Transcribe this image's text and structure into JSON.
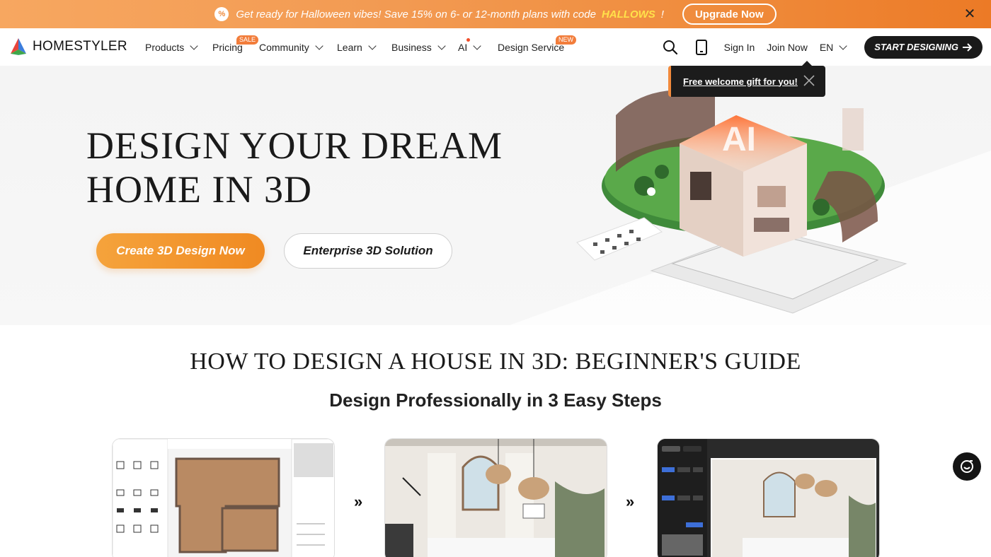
{
  "promo": {
    "text": "Get ready for Halloween vibes! Save 15% on 6- or 12-month plans with code",
    "code": "HALLOWS",
    "suffix": "!",
    "icon": "percent-icon",
    "upgrade_label": "Upgrade Now",
    "close_icon": "close-icon"
  },
  "nav": {
    "brand": "HOMESTYLER",
    "items": [
      {
        "label": "Products",
        "has_dropdown": true
      },
      {
        "label": "Pricing",
        "badge": "SALE"
      },
      {
        "label": "Community",
        "has_dropdown": true
      },
      {
        "label": "Learn",
        "has_dropdown": true
      },
      {
        "label": "Business",
        "has_dropdown": true
      },
      {
        "label": "AI",
        "has_dropdown": true
      },
      {
        "label": "Design Service",
        "badge": "NEW"
      }
    ],
    "sign_in": "Sign In",
    "join_now": "Join Now",
    "language": "EN",
    "start_designing": "START DESIGNING"
  },
  "tooltip": {
    "text": "Free welcome gift for you!"
  },
  "hero": {
    "title_line1": "DESIGN YOUR DREAM",
    "title_line2": "HOME IN 3D",
    "cta_primary": "Create 3D Design Now",
    "cta_secondary": "Enterprise 3D Solution"
  },
  "guide": {
    "title": "HOW TO DESIGN A HOUSE IN 3D: BEGINNER'S GUIDE",
    "subtitle": "Design Professionally in 3 Easy Steps"
  },
  "colors": {
    "accent": "#f08a22",
    "promo_start": "#f7a760",
    "promo_end": "#ec7a26",
    "badge": "#f27d3b",
    "dark": "#1a1a1a"
  }
}
